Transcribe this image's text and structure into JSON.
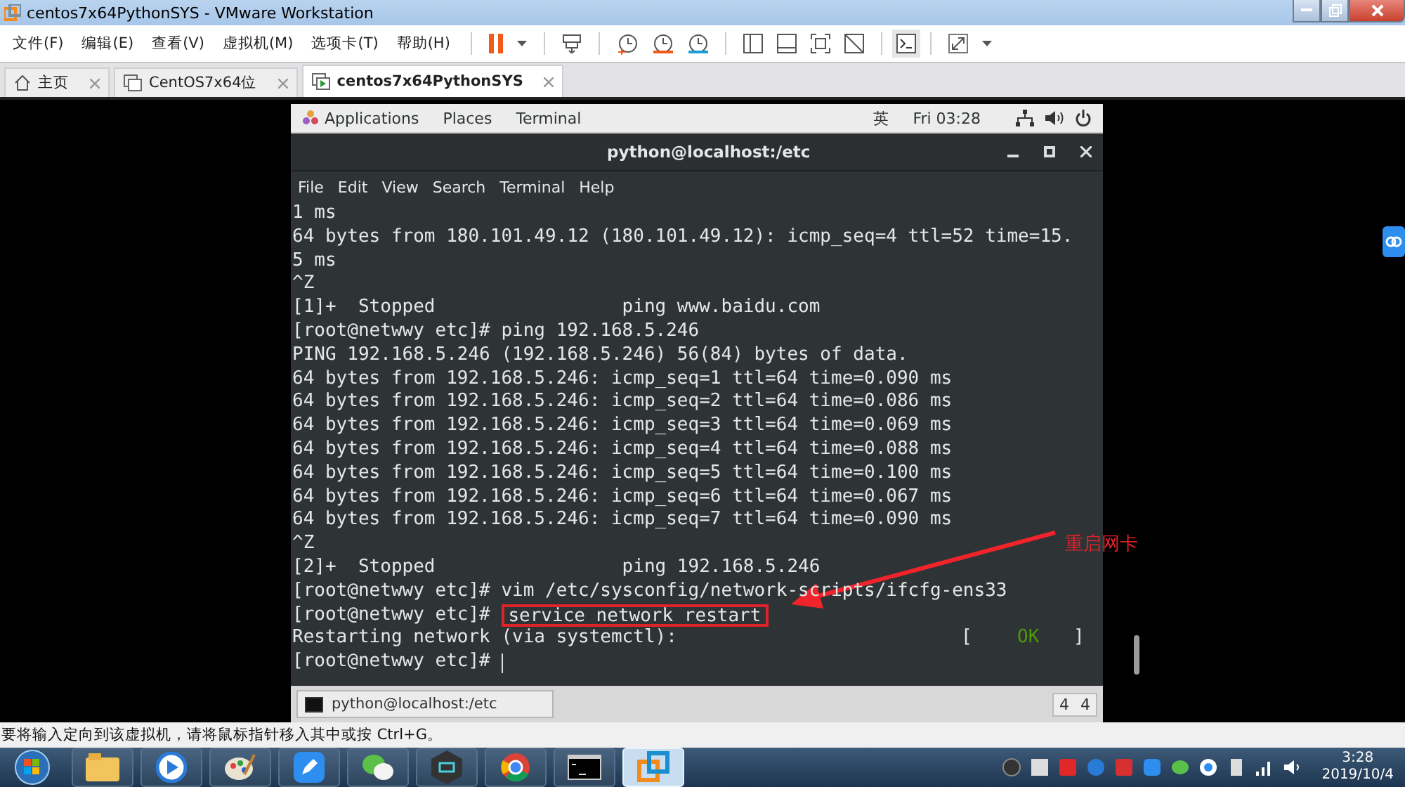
{
  "window": {
    "title": "centos7x64PythonSYS - VMware Workstation"
  },
  "menu": [
    "文件(F)",
    "编辑(E)",
    "查看(V)",
    "虚拟机(M)",
    "选项卡(T)",
    "帮助(H)"
  ],
  "tabs": [
    {
      "label": "主页",
      "kind": "home",
      "selected": false
    },
    {
      "label": "CentOS7x64位",
      "kind": "vm",
      "selected": false
    },
    {
      "label": "centos7x64PythonSYS",
      "kind": "vm",
      "selected": true
    }
  ],
  "gnome_bar": {
    "items": [
      "Applications",
      "Places",
      "Terminal"
    ],
    "input_method": "英",
    "clock": "Fri 03:28"
  },
  "terminal": {
    "title": "python@localhost:/etc",
    "menu": [
      "File",
      "Edit",
      "View",
      "Search",
      "Terminal",
      "Help"
    ],
    "lines": [
      {
        "kind": "plain",
        "text": "1 ms"
      },
      {
        "kind": "plain",
        "text": "64 bytes from 180.101.49.12 (180.101.49.12): icmp_seq=4 ttl=52 time=15."
      },
      {
        "kind": "plain",
        "text": "5 ms"
      },
      {
        "kind": "plain",
        "text": "^Z"
      },
      {
        "kind": "plain",
        "text": "[1]+  Stopped                 ping www.baidu.com"
      },
      {
        "kind": "plain",
        "text": "[root@netwwy etc]# ping 192.168.5.246"
      },
      {
        "kind": "plain",
        "text": "PING 192.168.5.246 (192.168.5.246) 56(84) bytes of data."
      },
      {
        "kind": "plain",
        "text": "64 bytes from 192.168.5.246: icmp_seq=1 ttl=64 time=0.090 ms"
      },
      {
        "kind": "plain",
        "text": "64 bytes from 192.168.5.246: icmp_seq=2 ttl=64 time=0.086 ms"
      },
      {
        "kind": "plain",
        "text": "64 bytes from 192.168.5.246: icmp_seq=3 ttl=64 time=0.069 ms"
      },
      {
        "kind": "plain",
        "text": "64 bytes from 192.168.5.246: icmp_seq=4 ttl=64 time=0.088 ms"
      },
      {
        "kind": "plain",
        "text": "64 bytes from 192.168.5.246: icmp_seq=5 ttl=64 time=0.100 ms"
      },
      {
        "kind": "plain",
        "text": "64 bytes from 192.168.5.246: icmp_seq=6 ttl=64 time=0.067 ms"
      },
      {
        "kind": "plain",
        "text": "64 bytes from 192.168.5.246: icmp_seq=7 ttl=64 time=0.090 ms"
      },
      {
        "kind": "plain",
        "text": "^Z"
      },
      {
        "kind": "plain",
        "text": "[2]+  Stopped                 ping 192.168.5.246"
      },
      {
        "kind": "plain",
        "text": "[root@netwwy etc]# vim /etc/sysconfig/network-scripts/ifcfg-ens33"
      },
      {
        "kind": "command",
        "prompt": "[root@netwwy etc]#",
        "text": "service network restart"
      },
      {
        "kind": "status",
        "text": "Restarting network (via systemctl):",
        "open": "[",
        "status": "OK",
        "close": "]"
      },
      {
        "kind": "command",
        "prompt": "[root@netwwy etc]#"
      }
    ]
  },
  "annotation": "重启网卡",
  "window_list": {
    "item": "python@localhost:/etc",
    "pager": [
      "4",
      "4"
    ]
  },
  "status_bar": "要将输入定向到该虚拟机，请将鼠标指针移入其中或按 Ctrl+G。",
  "taskbar": {
    "apps": [
      {
        "kind": "folder",
        "selected": false
      },
      {
        "kind": "player",
        "selected": false
      },
      {
        "kind": "paint",
        "selected": false
      },
      {
        "kind": "pen",
        "selected": false
      },
      {
        "kind": "chat",
        "selected": false
      },
      {
        "kind": "nox",
        "selected": false
      },
      {
        "kind": "browser",
        "selected": false
      },
      {
        "kind": "console",
        "selected": false
      },
      {
        "kind": "vmware",
        "selected": true
      }
    ],
    "time": "3:28",
    "date": "2019/10/4"
  }
}
